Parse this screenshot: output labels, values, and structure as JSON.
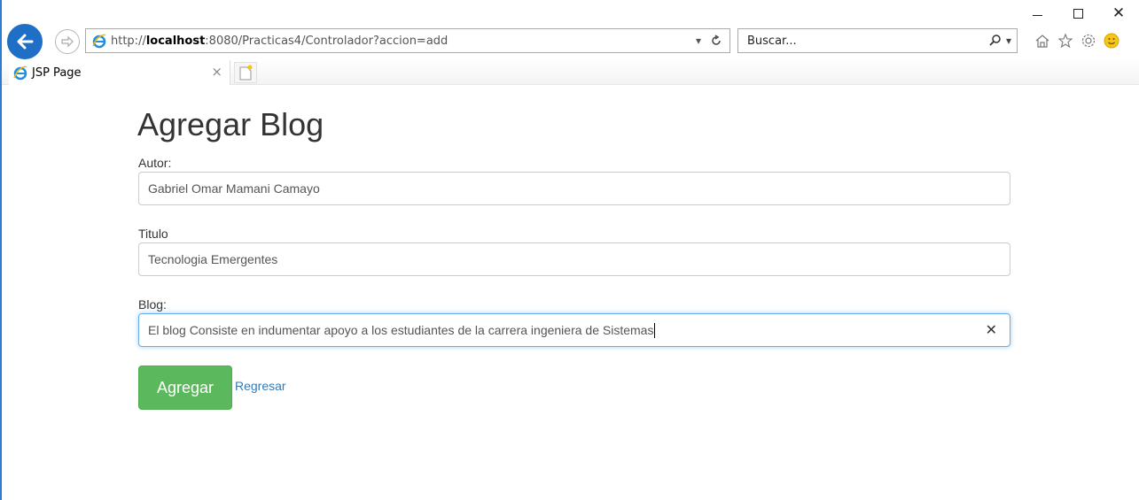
{
  "browser": {
    "address": {
      "protocol": "http://",
      "host": "localhost",
      "rest": ":8080/Practicas4/Controlador?accion=add"
    },
    "search": {
      "placeholder": "Buscar..."
    },
    "tab": {
      "title": "JSP Page"
    },
    "window_controls": {
      "close_glyph": "✕"
    },
    "colors": {
      "accent": "#1f6fc6",
      "link": "#337ab7",
      "success": "#5cb85c"
    }
  },
  "page": {
    "title": "Agregar Blog",
    "fields": [
      {
        "label": "Autor:",
        "value": "Gabriel Omar Mamani Camayo"
      },
      {
        "label": "Titulo",
        "value": "Tecnologia Emergentes"
      },
      {
        "label": "Blog:",
        "value": "El blog Consiste en indumentar apoyo a los estudiantes de la carrera ingeniera de Sistemas"
      }
    ],
    "submit_label": "Agregar",
    "back_link": "Regresar"
  }
}
